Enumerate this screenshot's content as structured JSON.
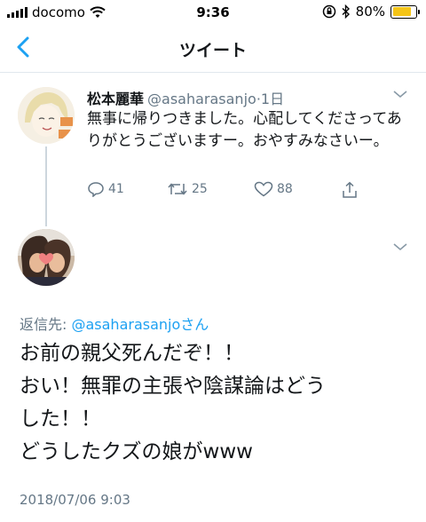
{
  "status_bar": {
    "carrier": "docomo",
    "time": "9:36",
    "battery": "80%",
    "battery_level": 0.8,
    "battery_color": "#f5c518"
  },
  "nav": {
    "back_icon": "chevron-left-icon",
    "title": "ツイート"
  },
  "parent_tweet": {
    "display_name": "松本麗華",
    "handle": "@asaharasanjo",
    "age": "·1日",
    "text": "無事に帰りつきました。心配してくださってありがとうございますー。おやすみなさいー。",
    "replies": "41",
    "retweets": "25",
    "likes": "88"
  },
  "reply_tweet": {
    "reply_to_prefix": "返信先: ",
    "reply_to_handle": "@asaharasanjo",
    "reply_to_suffix": "さん",
    "lines": [
      "お前の親父死んだぞ！！",
      "おい！無罪の主張や陰謀論はどう",
      "した！！",
      "どうしたクズの娘がwww"
    ],
    "timestamp": "2018/07/06 9:03"
  },
  "colors": {
    "accent": "#1da1f2",
    "secondary_text": "#657786",
    "primary_text": "#14171a",
    "divider": "#e1e8ed"
  }
}
